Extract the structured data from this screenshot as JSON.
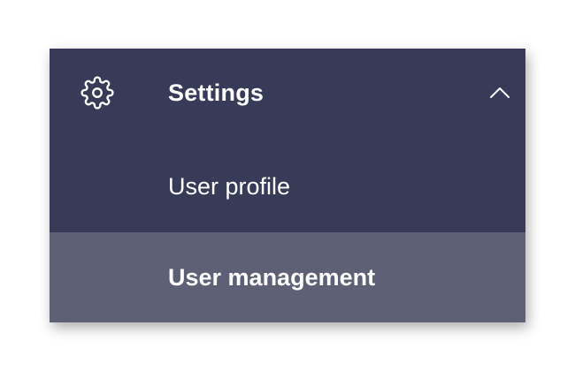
{
  "menu": {
    "header": {
      "title": "Settings",
      "icon": "gear-icon",
      "toggle_icon": "chevron-up-icon",
      "expanded": true
    },
    "items": [
      {
        "label": "User profile",
        "active": false
      },
      {
        "label": "User management",
        "active": true
      }
    ]
  },
  "colors": {
    "panel_background": "#383b57",
    "active_item_background": "#5e6076",
    "text": "#ffffff"
  }
}
